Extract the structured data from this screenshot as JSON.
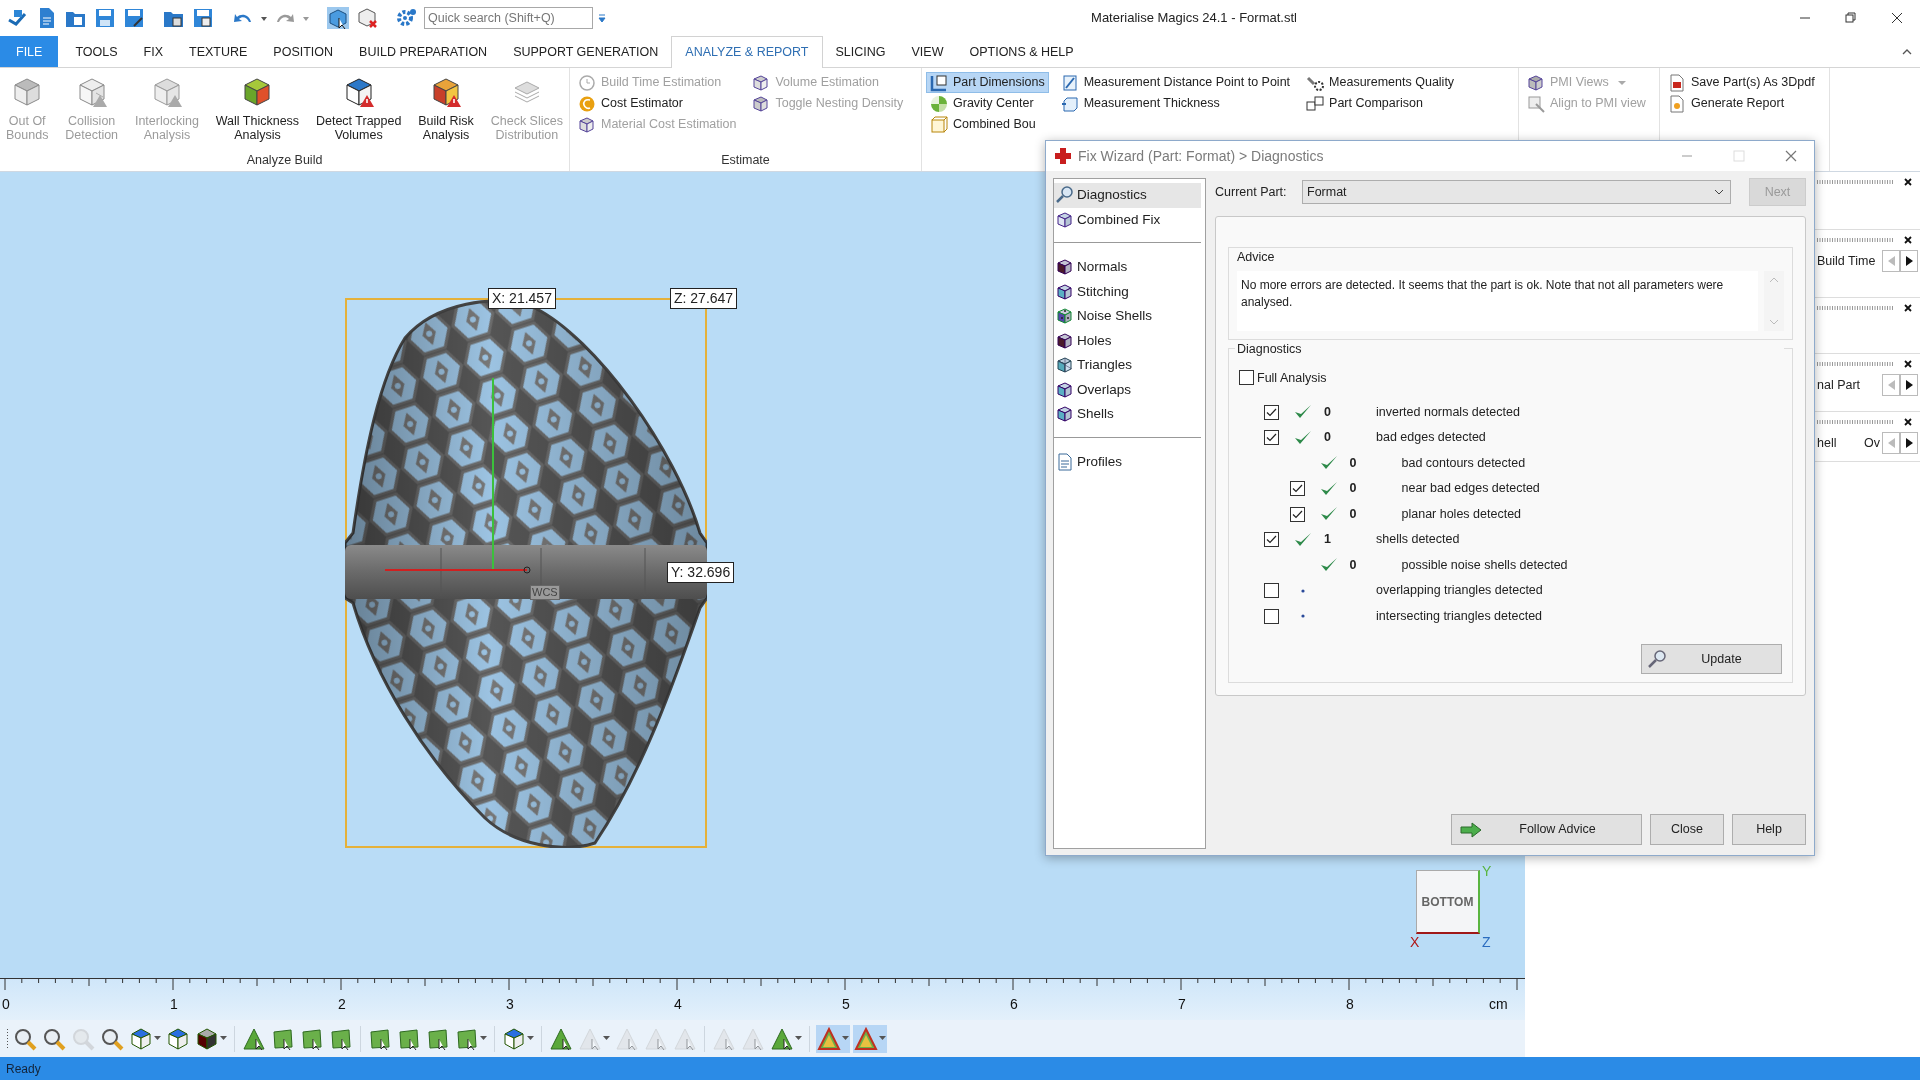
{
  "window": {
    "title": "Materialise Magics 24.1 - Format.stl"
  },
  "quick_search": {
    "placeholder": "Quick search (Shift+Q)"
  },
  "ribbon_tabs": [
    {
      "label": "FILE",
      "kind": "backstage",
      "selected": false
    },
    {
      "label": "TOOLS",
      "kind": "tab",
      "selected": false
    },
    {
      "label": "FIX",
      "kind": "tab",
      "selected": false
    },
    {
      "label": "TEXTURE",
      "kind": "tab",
      "selected": false
    },
    {
      "label": "POSITION",
      "kind": "tab",
      "selected": false
    },
    {
      "label": "BUILD PREPARATION",
      "kind": "tab",
      "selected": false
    },
    {
      "label": "SUPPORT GENERATION",
      "kind": "tab",
      "selected": false
    },
    {
      "label": "ANALYZE & REPORT",
      "kind": "tab",
      "selected": true
    },
    {
      "label": "SLICING",
      "kind": "tab",
      "selected": false
    },
    {
      "label": "VIEW",
      "kind": "tab",
      "selected": false
    },
    {
      "label": "OPTIONS & HELP",
      "kind": "tab",
      "selected": false
    }
  ],
  "ribbon_groups": [
    {
      "label": "Analyze Build",
      "kind": "large",
      "items": [
        {
          "label": "Out Of\nBounds",
          "disabled": true
        },
        {
          "label": "Collision\nDetection",
          "disabled": true
        },
        {
          "label": "Interlocking\nAnalysis",
          "disabled": true
        },
        {
          "label": "Wall Thickness\nAnalysis",
          "disabled": false
        },
        {
          "label": "Detect Trapped\nVolumes",
          "disabled": false
        },
        {
          "label": "Build Risk\nAnalysis",
          "disabled": false
        },
        {
          "label": "Check Slices\nDistribution",
          "disabled": true
        }
      ]
    },
    {
      "label": "Estimate",
      "kind": "small",
      "columns": [
        {
          "items": [
            {
              "label": "Build Time Estimation",
              "disabled": true,
              "active": false,
              "dropdown": false
            },
            {
              "label": "Cost Estimator",
              "disabled": false,
              "active": false,
              "dropdown": false
            },
            {
              "label": "Material Cost Estimation",
              "disabled": true,
              "active": false,
              "dropdown": false
            }
          ]
        },
        {
          "items": [
            {
              "label": "Volume Estimation",
              "disabled": true,
              "active": false,
              "dropdown": false
            },
            {
              "label": "Toggle Nesting Density",
              "disabled": true,
              "active": false,
              "dropdown": false
            }
          ]
        }
      ]
    },
    {
      "kind": "small",
      "columns": [
        {
          "items": [
            {
              "label": "Part Dimensions",
              "disabled": false,
              "active": true,
              "dropdown": false
            },
            {
              "label": "Gravity Center",
              "disabled": false,
              "active": false,
              "dropdown": false
            },
            {
              "label": "Combined Bou",
              "disabled": false,
              "active": false,
              "dropdown": false
            }
          ]
        },
        {
          "items": [
            {
              "label": "Measurement Distance Point to Point",
              "disabled": false,
              "active": false,
              "dropdown": false
            },
            {
              "label": "Measurement Thickness",
              "disabled": false,
              "active": false,
              "dropdown": false
            }
          ]
        },
        {
          "items": [
            {
              "label": "Measurements Quality",
              "disabled": false,
              "active": false,
              "dropdown": false
            },
            {
              "label": "Part Comparison",
              "disabled": false,
              "active": false,
              "dropdown": false
            }
          ]
        }
      ]
    },
    {
      "kind": "small",
      "columns": [
        {
          "items": [
            {
              "label": "PMI Views",
              "disabled": true,
              "active": false,
              "dropdown": true
            },
            {
              "label": "Align to PMI view",
              "disabled": true,
              "active": false,
              "dropdown": false
            }
          ]
        }
      ]
    },
    {
      "kind": "small",
      "columns": [
        {
          "items": [
            {
              "label": "Save Part(s) As 3Dpdf",
              "disabled": false,
              "active": false,
              "dropdown": false
            },
            {
              "label": "Generate Report",
              "disabled": false,
              "active": false,
              "dropdown": false
            }
          ]
        }
      ]
    }
  ],
  "viewport": {
    "dimension_labels": [
      {
        "text": "X: 21.457"
      },
      {
        "text": "Z: 27.647"
      },
      {
        "text": "Y: 32.696"
      }
    ],
    "wcs_label": "WCS",
    "view_cube": {
      "face": "BOTTOM",
      "x_axis": "X",
      "y_axis": "Y",
      "z_axis": "Z"
    },
    "ruler": {
      "ticks": [
        "0",
        "1",
        "2",
        "3",
        "4",
        "5",
        "6",
        "7",
        "8"
      ],
      "unit": "cm"
    }
  },
  "bottom_toolbar": {
    "buttons": [
      {
        "kind": "zoom",
        "disabled": false,
        "active": false,
        "caret": false
      },
      {
        "kind": "zoom",
        "disabled": false,
        "active": false,
        "caret": false
      },
      {
        "kind": "zoom",
        "disabled": true,
        "active": false,
        "caret": false
      },
      {
        "kind": "zoom",
        "disabled": false,
        "active": false,
        "caret": false
      },
      {
        "kind": "cube",
        "disabled": false,
        "active": false,
        "caret": true
      },
      {
        "kind": "cube",
        "disabled": false,
        "active": false,
        "caret": false
      },
      {
        "kind": "solid-cube",
        "disabled": false,
        "active": false,
        "caret": true
      },
      {
        "kind": "separator"
      },
      {
        "kind": "triangle",
        "disabled": false,
        "active": false,
        "caret": false
      },
      {
        "kind": "green-shape",
        "disabled": false,
        "active": false,
        "caret": false
      },
      {
        "kind": "green-shape",
        "disabled": false,
        "active": false,
        "caret": false
      },
      {
        "kind": "green-shape",
        "disabled": false,
        "active": false,
        "caret": false
      },
      {
        "kind": "separator"
      },
      {
        "kind": "green-shape",
        "disabled": false,
        "active": false,
        "caret": false
      },
      {
        "kind": "green-shape",
        "disabled": false,
        "active": false,
        "caret": false
      },
      {
        "kind": "green-shape",
        "disabled": false,
        "active": false,
        "caret": false
      },
      {
        "kind": "green-shape",
        "disabled": false,
        "active": false,
        "caret": true
      },
      {
        "kind": "separator"
      },
      {
        "kind": "cube",
        "disabled": false,
        "active": false,
        "caret": true
      },
      {
        "kind": "separator"
      },
      {
        "kind": "triangle",
        "disabled": false,
        "active": false,
        "caret": false
      },
      {
        "kind": "triangle",
        "disabled": true,
        "active": false,
        "caret": true
      },
      {
        "kind": "triangle",
        "disabled": true,
        "active": false,
        "caret": false
      },
      {
        "kind": "triangle",
        "disabled": true,
        "active": false,
        "caret": false
      },
      {
        "kind": "triangle",
        "disabled": true,
        "active": false,
        "caret": false
      },
      {
        "kind": "separator"
      },
      {
        "kind": "triangle",
        "disabled": true,
        "active": false,
        "caret": false
      },
      {
        "kind": "triangle",
        "disabled": true,
        "active": false,
        "caret": false
      },
      {
        "kind": "triangle",
        "disabled": false,
        "active": false,
        "caret": true
      },
      {
        "kind": "separator"
      },
      {
        "kind": "color-triangle",
        "disabled": false,
        "active": true,
        "caret": true
      },
      {
        "kind": "color-triangle",
        "disabled": false,
        "active": true,
        "caret": true
      }
    ]
  },
  "side_panels": [
    {
      "closable": true
    },
    {
      "closable": true,
      "row_texts": [
        "Build Time"
      ]
    },
    {
      "closable": true
    },
    {
      "closable": true,
      "row_texts": [
        "nal Part"
      ]
    },
    {
      "closable": true,
      "row_texts": [
        "hell",
        "Ov"
      ]
    }
  ],
  "dialog": {
    "title": "Fix Wizard (Part: Format) > Diagnostics",
    "nav_sections": [
      {
        "items": [
          {
            "label": "Diagnostics",
            "selected": true
          },
          {
            "label": "Combined Fix",
            "selected": false
          }
        ]
      },
      {
        "items": [
          {
            "label": "Normals",
            "selected": false
          },
          {
            "label": "Stitching",
            "selected": false
          },
          {
            "label": "Noise Shells",
            "selected": false
          },
          {
            "label": "Holes",
            "selected": false
          },
          {
            "label": "Triangles",
            "selected": false
          },
          {
            "label": "Overlaps",
            "selected": false
          },
          {
            "label": "Shells",
            "selected": false
          }
        ]
      },
      {
        "items": [
          {
            "label": "Profiles",
            "selected": false
          }
        ]
      }
    ],
    "current_part": {
      "label": "Current Part:",
      "value": "Format"
    },
    "next_button": {
      "label": "Next",
      "disabled": true
    },
    "advice": {
      "title": "Advice",
      "text": "No more errors are detected. It seems that the part is ok. Note that not all parameters were analysed."
    },
    "diagnostics": {
      "title": "Diagnostics",
      "full_analysis": {
        "label": "Full Analysis",
        "checked": false
      },
      "rows": [
        {
          "kind": "checkbox",
          "checked": true,
          "passed": true,
          "count": "0",
          "label": "inverted normals detected"
        },
        {
          "kind": "checkbox",
          "checked": true,
          "passed": true,
          "count": "0",
          "label": "bad edges detected",
          "children": [
            {
              "kind": "plain",
              "passed": true,
              "count": "0",
              "label": "bad contours detected"
            },
            {
              "kind": "checkbox",
              "checked": true,
              "passed": true,
              "count": "0",
              "label": "near bad edges detected"
            },
            {
              "kind": "checkbox",
              "checked": true,
              "passed": true,
              "count": "0",
              "label": "planar holes detected"
            }
          ]
        },
        {
          "kind": "checkbox",
          "checked": true,
          "passed": true,
          "count": "1",
          "label": "shells detected",
          "children": [
            {
              "kind": "plain",
              "passed": true,
              "count": "0",
              "label": "possible noise shells detected"
            }
          ]
        },
        {
          "kind": "checkbox",
          "checked": false,
          "passed": false,
          "label": "overlapping triangles detected"
        },
        {
          "kind": "checkbox",
          "checked": false,
          "passed": false,
          "label": "intersecting triangles detected"
        }
      ],
      "update_button": "Update"
    },
    "footer_buttons": [
      "Follow Advice",
      "Close",
      "Help"
    ]
  },
  "status_bar": {
    "text": "Ready"
  }
}
